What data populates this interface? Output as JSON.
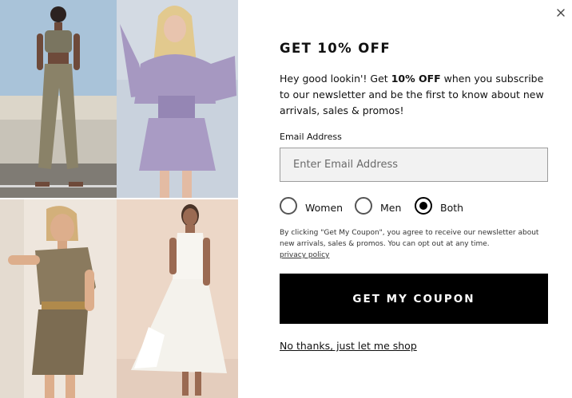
{
  "popup": {
    "title": "GET 10% OFF",
    "intro_before": "Hey good lookin'! Get ",
    "intro_bold": "10% OFF",
    "intro_after": " when you subscribe to our newsletter and be the first to know about new arrivals, sales & promos!",
    "email": {
      "label": "Email Address",
      "placeholder": "Enter Email Address",
      "value": ""
    },
    "preferences": [
      {
        "label": "Women",
        "selected": false
      },
      {
        "label": "Men",
        "selected": false
      },
      {
        "label": "Both",
        "selected": true
      }
    ],
    "legal_text": "By clicking \"Get My Coupon\", you agree to receive our newsletter about new arrivals, sales & promos. You can opt out at any time.",
    "privacy_link": "privacy policy",
    "cta_label": "GET MY COUPON",
    "decline_label": "No thanks, just let me shop"
  },
  "gallery": {
    "photos": [
      {
        "subject": "model in olive crop top and joggers"
      },
      {
        "subject": "model in lavender floral smocked mini dress"
      },
      {
        "subject": "model in one-shoulder paisley print dress"
      },
      {
        "subject": "model in white lace maxi dress"
      }
    ]
  },
  "icons": {
    "close": "close-icon"
  },
  "colors": {
    "cta_background": "#000000",
    "cta_text": "#ffffff",
    "input_background": "#f2f2f2",
    "input_border": "#9c9c9c"
  }
}
